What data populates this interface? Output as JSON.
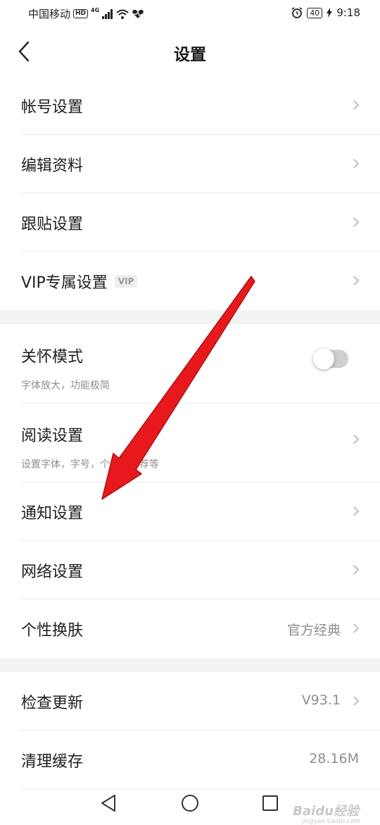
{
  "status_bar": {
    "carrier": "中国移动",
    "hd": "HD",
    "network": "4G",
    "battery": "40",
    "time": "9:18"
  },
  "header": {
    "title": "设置"
  },
  "groups": [
    [
      {
        "label": "帐号设置"
      },
      {
        "label": "编辑资料"
      },
      {
        "label": "跟贴设置"
      },
      {
        "label": "VIP专属设置",
        "badge": "VIP"
      }
    ],
    [
      {
        "label": "关怀模式",
        "sub": "字体放大，功能极简"
      },
      {
        "label": "阅读设置",
        "sub": "设置字体，字号，个性化推荐等"
      },
      {
        "label": "通知设置"
      },
      {
        "label": "网络设置"
      },
      {
        "label": "个性换肤",
        "value": "官方经典"
      }
    ],
    [
      {
        "label": "检查更新",
        "value": "V93.1"
      },
      {
        "label": "清理缓存",
        "value": "28.16M"
      }
    ]
  ],
  "watermark": {
    "text": "Baidu经验",
    "sub": "jingyan.baidu.com"
  },
  "colors": {
    "arrow": "#e8191c",
    "toggle_off": "#cfcfcf"
  },
  "care_mode_enabled": false
}
